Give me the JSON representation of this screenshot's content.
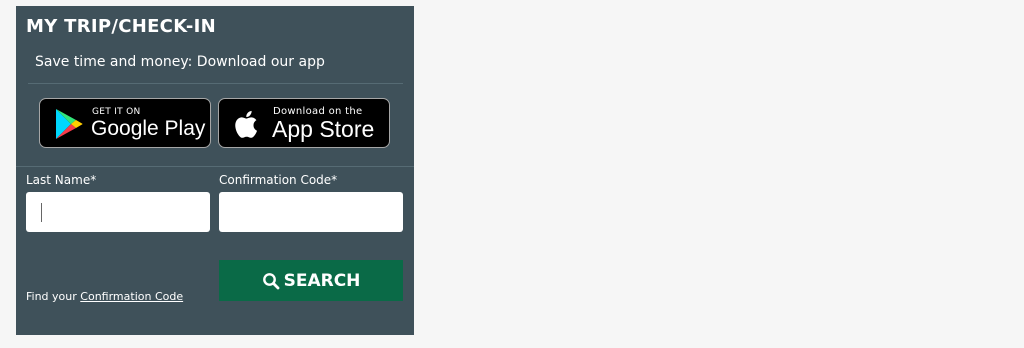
{
  "checkin": {
    "title": "MY TRIP/CHECK-IN",
    "promo_text": "Save time and money: Download our app",
    "google_play": {
      "small_text": "GET IT ON",
      "big_text": "Google Play",
      "icon": "google-play-icon"
    },
    "app_store": {
      "small_text": "Download on the",
      "big_text": "App Store",
      "icon": "apple-icon"
    },
    "last_name": {
      "label": "Last Name*",
      "value": ""
    },
    "confirmation_code": {
      "label": "Confirmation Code*",
      "value": ""
    },
    "search_label": "SEARCH",
    "find_prefix": "Find your",
    "find_link": "Confirmation Code",
    "colors": {
      "panel": "#3f515a",
      "button": "#0a6a47",
      "page_background": "#f6f6f6"
    }
  }
}
